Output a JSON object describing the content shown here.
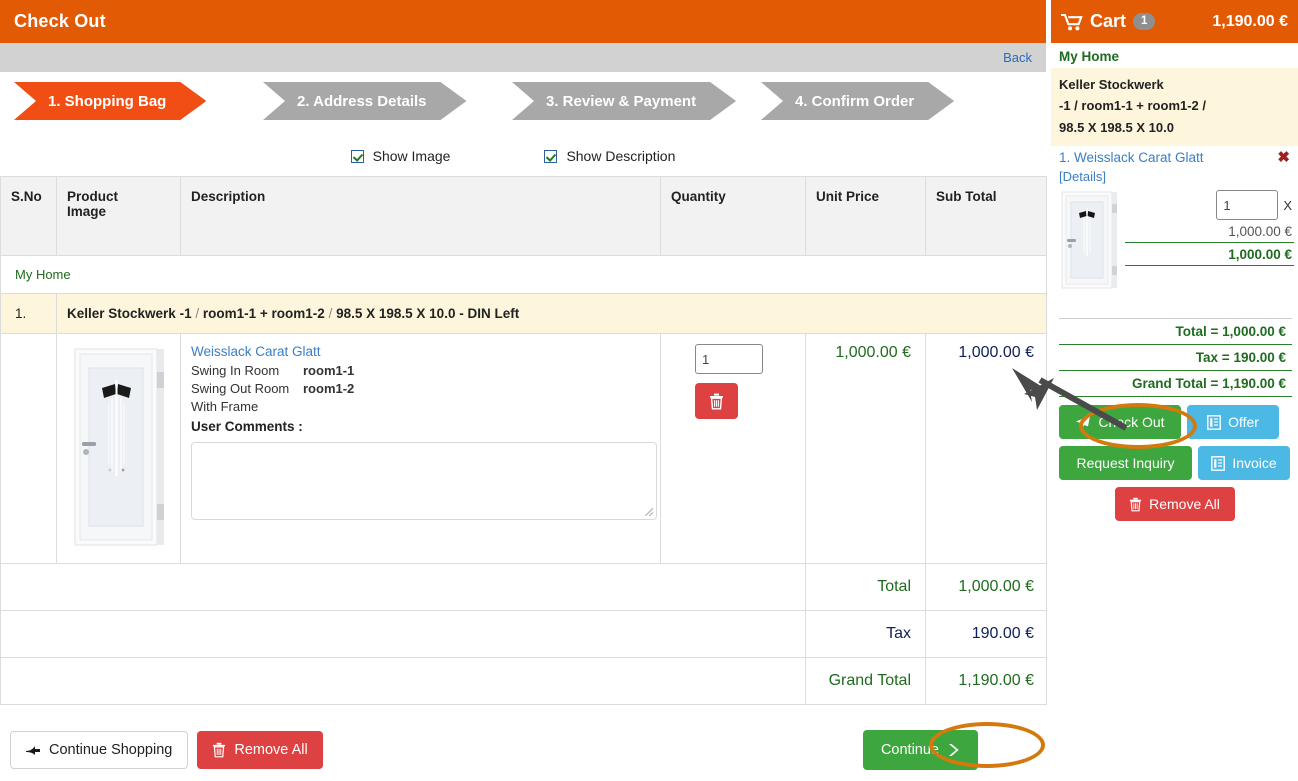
{
  "header": {
    "title": "Check Out",
    "back_label": "Back",
    "accent_color": "#e35a05"
  },
  "steps": [
    {
      "label": "1. Shopping Bag",
      "active": true
    },
    {
      "label": "2. Address Details",
      "active": false
    },
    {
      "label": "3. Review & Payment",
      "active": false
    },
    {
      "label": "4. Confirm Order",
      "active": false
    }
  ],
  "options": {
    "show_image_label": "Show Image",
    "show_image_checked": true,
    "show_description_label": "Show Description",
    "show_description_checked": true
  },
  "table": {
    "group_caption": "My Home",
    "headers": {
      "sno": "S.No",
      "product_image": "Product Image",
      "description": "Description",
      "quantity": "Quantity",
      "unit_price": "Unit Price",
      "sub_total": "Sub Total"
    },
    "group_row": {
      "sno": "1.",
      "name": "Keller Stockwerk",
      "floor": "-1",
      "rooms": "room1-1 + room1-2",
      "dimensions": "98.5 X 198.5 X 10.0",
      "variant": "- DIN Left"
    },
    "item": {
      "product_link": "Weisslack Carat Glatt",
      "attr_swing_in_key": "Swing In Room",
      "attr_swing_in_value": "room1-1",
      "attr_swing_out_key": "Swing Out Room",
      "attr_swing_out_value": "room1-2",
      "attr_frame": "With Frame",
      "user_comments_label": "User Comments :",
      "user_comments_value": "",
      "quantity": "1",
      "unit_price": "1,000.00 €",
      "sub_total": "1,000.00 €"
    },
    "totals": [
      {
        "label": "Total",
        "value": "1,000.00 €",
        "style": "green"
      },
      {
        "label": "Tax",
        "value": "190.00 €",
        "style": "navy"
      },
      {
        "label": "Grand Total",
        "value": "1,190.00 €",
        "style": "green"
      }
    ]
  },
  "footer": {
    "continue_shopping": "Continue Shopping",
    "remove_all": "Remove All",
    "continue": "Continue"
  },
  "cart": {
    "title": "Cart",
    "count": "1",
    "total": "1,190.00 €",
    "my_home": "My Home",
    "product_name": "Keller Stockwerk",
    "product_spec": "-1 / room1-1 + room1-2 /",
    "product_dims": "98.5 X 198.5 X 10.0",
    "item_link": "1. Weisslack Carat Glatt",
    "details_link": "[Details]",
    "remove_x": "✖",
    "quantity": "1",
    "multiply_sign": "X",
    "unit_price": "1,000.00 €",
    "line_total": "1,000.00 €",
    "total_line": "Total = 1,000.00 €",
    "tax_line": "Tax = 190.00 €",
    "grand_total_line": "Grand Total = 1,190.00 €",
    "buttons": {
      "check_out": "Check Out",
      "offer": "Offer",
      "request_inquiry": "Request Inquiry",
      "invoice": "Invoice",
      "remove_all": "Remove All"
    }
  },
  "annotations": {
    "highlight_color": "#d4790e",
    "arrow_color": "#4a4a4a"
  }
}
